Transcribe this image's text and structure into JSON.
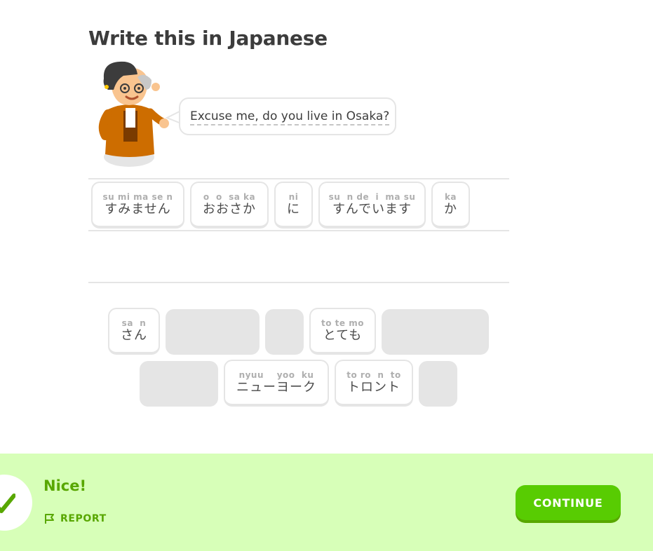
{
  "prompt": {
    "title": "Write this in Japanese",
    "sentence": "Excuse me, do you live in Osaka?"
  },
  "answer": [
    {
      "reading": "su mi ma se n",
      "text": "すみません"
    },
    {
      "reading": "o  o  sa ka",
      "text": "おおさか"
    },
    {
      "reading": "ni",
      "text": "に"
    },
    {
      "reading": "su  n de  i  ma su",
      "text": "すんでいます"
    },
    {
      "reading": "ka",
      "text": "か"
    }
  ],
  "bank": [
    {
      "reading": "sa  n",
      "text": "さん"
    },
    {
      "reading": "to te mo",
      "text": "とても"
    },
    {
      "reading": "nyuu    yoo  ku",
      "text": "ニューヨーク"
    },
    {
      "reading": "to ro  n  to",
      "text": "トロント"
    }
  ],
  "footer": {
    "status": "Nice!",
    "report_label": "REPORT",
    "continue_label": "CONTINUE"
  },
  "colors": {
    "success_bg": "#d7ffb8",
    "success_text": "#58a700",
    "button": "#58cc02",
    "button_shadow": "#58a700",
    "chip_border": "#e5e5e5",
    "slot": "#e5e5e5"
  },
  "icons": {
    "character": "character-illustration",
    "check": "check-icon",
    "report": "flag-icon"
  }
}
